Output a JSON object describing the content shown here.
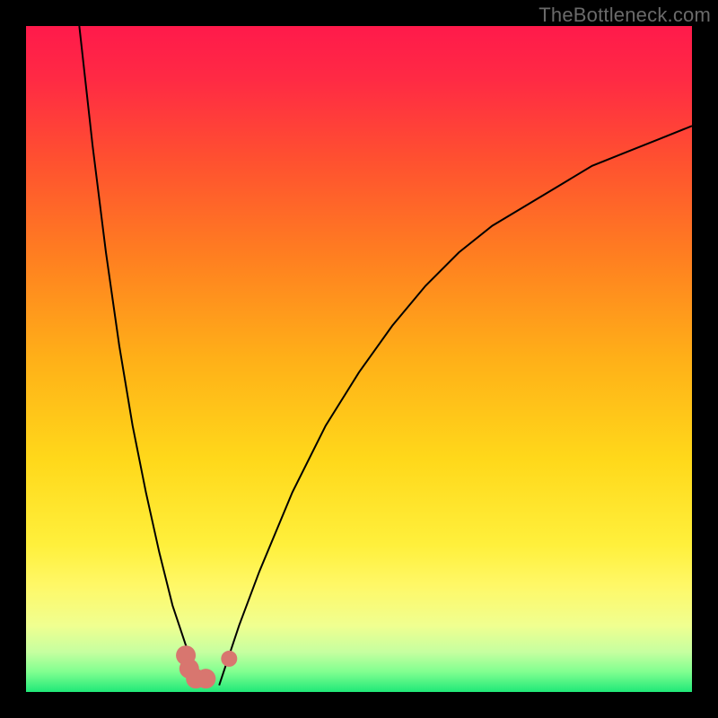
{
  "watermark": {
    "text": "TheBottleneck.com"
  },
  "colors": {
    "black": "#000000",
    "curve_stroke": "#000000",
    "marker_fill": "#d8766f",
    "gradient_stops": [
      {
        "offset": 0.0,
        "color": "#ff1a4b"
      },
      {
        "offset": 0.08,
        "color": "#ff2a44"
      },
      {
        "offset": 0.2,
        "color": "#ff5030"
      },
      {
        "offset": 0.35,
        "color": "#ff8020"
      },
      {
        "offset": 0.5,
        "color": "#ffb018"
      },
      {
        "offset": 0.65,
        "color": "#ffd81a"
      },
      {
        "offset": 0.78,
        "color": "#fff03c"
      },
      {
        "offset": 0.84,
        "color": "#fff867"
      },
      {
        "offset": 0.9,
        "color": "#f0ff90"
      },
      {
        "offset": 0.94,
        "color": "#c6ffa0"
      },
      {
        "offset": 0.97,
        "color": "#80ff90"
      },
      {
        "offset": 1.0,
        "color": "#20e878"
      }
    ]
  },
  "chart_data": {
    "type": "line",
    "title": "",
    "xlabel": "",
    "ylabel": "",
    "xlim": [
      0,
      100
    ],
    "ylim": [
      0,
      100
    ],
    "series": [
      {
        "name": "left-curve",
        "x": [
          8,
          10,
          12,
          14,
          16,
          18,
          20,
          21,
          22,
          23,
          24,
          25,
          26,
          27
        ],
        "values": [
          100,
          82,
          66,
          52,
          40,
          30,
          21,
          17,
          13,
          10,
          7,
          5,
          3,
          1
        ]
      },
      {
        "name": "right-curve",
        "x": [
          29,
          30,
          32,
          35,
          40,
          45,
          50,
          55,
          60,
          65,
          70,
          75,
          80,
          85,
          90,
          95,
          100
        ],
        "values": [
          1,
          4,
          10,
          18,
          30,
          40,
          48,
          55,
          61,
          66,
          70,
          73,
          76,
          79,
          81,
          83,
          85
        ]
      }
    ],
    "markers": [
      {
        "name": "marker-left-base",
        "x": 24.0,
        "y": 5.5
      },
      {
        "name": "marker-left-mid",
        "x": 24.5,
        "y": 3.5
      },
      {
        "name": "marker-left-low",
        "x": 25.5,
        "y": 2.0
      },
      {
        "name": "marker-left-jog",
        "x": 27.0,
        "y": 2.0
      },
      {
        "name": "marker-right-dot",
        "x": 30.5,
        "y": 5.0
      }
    ]
  }
}
